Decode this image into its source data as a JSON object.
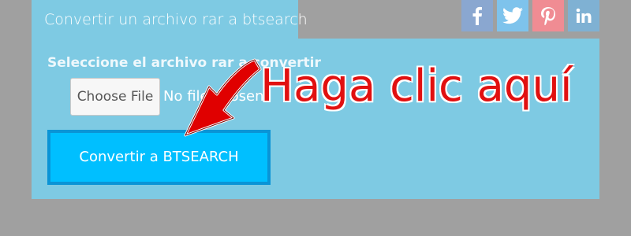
{
  "tab": {
    "title": "Convertir un archivo rar a btsearch"
  },
  "form": {
    "label": "Seleccione el archivo rar a convertir",
    "choose_file_label": "Choose File",
    "file_status": "No file chosen",
    "convert_button_label": "Convertir a BTSEARCH"
  },
  "annotation": {
    "callout_text": "Haga clic aquí"
  },
  "social": [
    "facebook-icon",
    "twitter-icon",
    "pinterest-icon",
    "linkedin-icon"
  ],
  "colors": {
    "page_bg": "#a0a0a0",
    "panel_bg": "#7ecae3",
    "button_bg": "#00bfff",
    "button_border": "#0a94d6",
    "callout": "#e11010"
  }
}
